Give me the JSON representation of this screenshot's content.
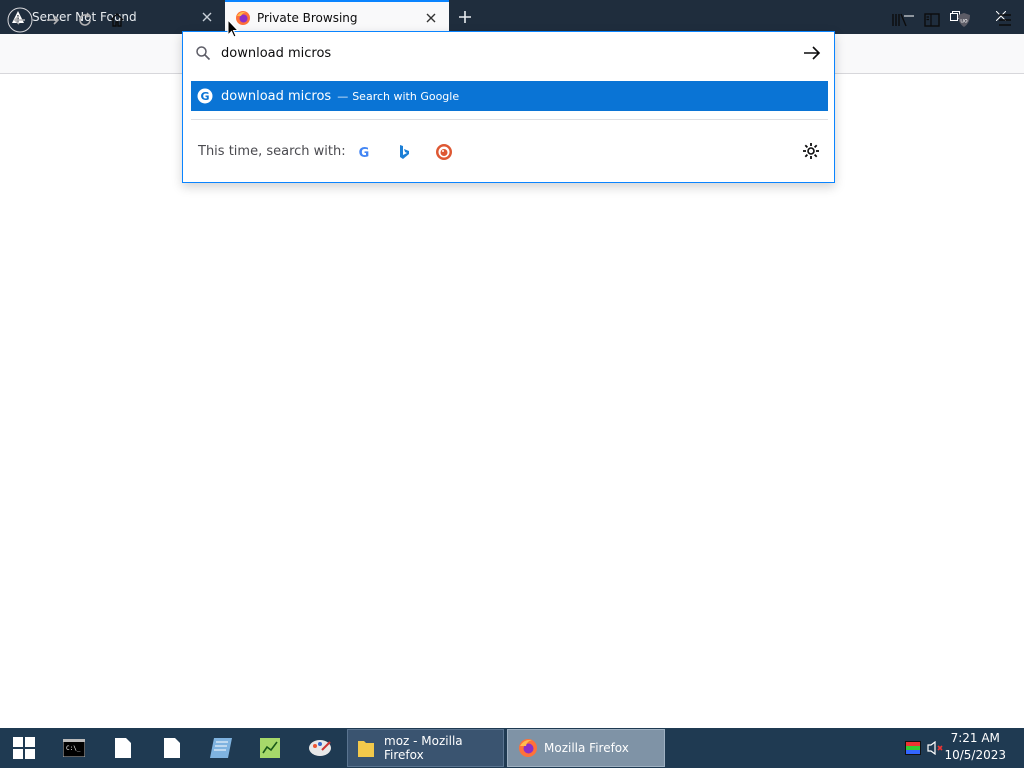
{
  "tabs": [
    {
      "label": "Server Not Found",
      "icon": "warning-icon"
    },
    {
      "label": "Private Browsing",
      "icon": "firefox-icon"
    }
  ],
  "urlbar": {
    "value": "download micros",
    "result_text": "download micros",
    "result_dash": "—",
    "result_action": "Search with Google",
    "search_with_label": "This time, search with:",
    "engines": [
      "google-icon",
      "bing-icon",
      "duckduckgo-icon"
    ]
  },
  "taskbar": {
    "apps": [
      {
        "label": "moz - Mozilla Firefox",
        "icon": "folder-icon"
      },
      {
        "label": "Mozilla Firefox",
        "icon": "firefox-icon"
      }
    ],
    "time": "7:21 AM",
    "date": "10/5/2023"
  },
  "colors": {
    "tabbar": "#1f2d3d",
    "accent": "#0a84ff",
    "result_highlight": "#0a74d5",
    "taskbar": "#1f3a52"
  }
}
